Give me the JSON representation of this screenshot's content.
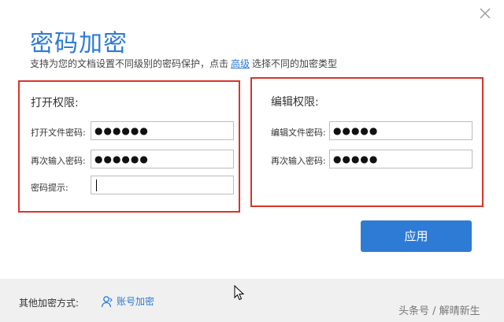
{
  "dialog": {
    "title": "密码加密",
    "subtitle_prefix": "支持为您的文档设置不同级别的密码保护，点击",
    "subtitle_link": "高级",
    "subtitle_suffix": "选择不同的加密类型"
  },
  "open_panel": {
    "title": "打开权限:",
    "password_label": "打开文件密码:",
    "password_value": "●●●●●●",
    "confirm_label": "再次输入密码:",
    "confirm_value": "●●●●●●",
    "hint_label": "密码提示:",
    "hint_value": ""
  },
  "edit_panel": {
    "title": "编辑权限:",
    "password_label": "编辑文件密码:",
    "password_value": "●●●●●",
    "confirm_label": "再次输入密码:",
    "confirm_value": "●●●●●"
  },
  "apply_label": "应用",
  "footer": {
    "label": "其他加密方式:",
    "account_link": "账号加密"
  },
  "watermark": "头条号 / 解晴新生",
  "colors": {
    "accent": "#2e7bd6",
    "highlight_border": "#d9342b"
  },
  "icons": {
    "close": "close-icon",
    "account": "user-icon",
    "cursor": "mouse-cursor-icon"
  }
}
